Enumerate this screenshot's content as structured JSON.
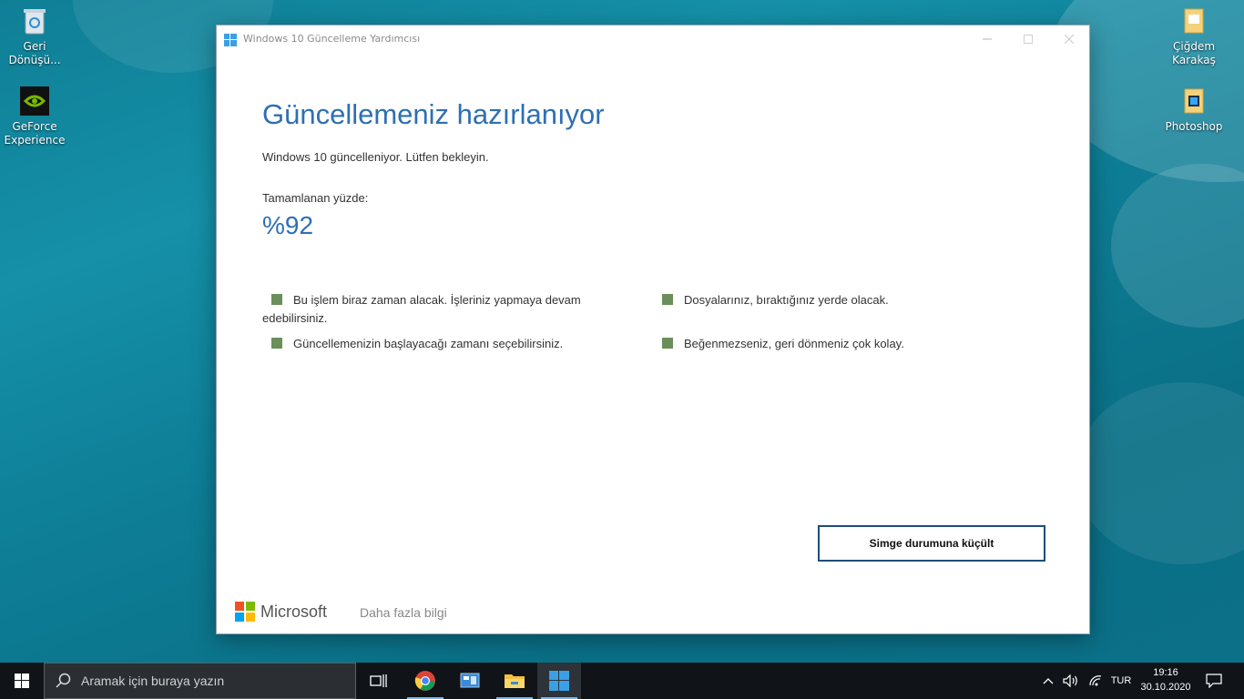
{
  "desktop": {
    "icons": [
      {
        "label": "Geri Dönüşü..."
      },
      {
        "label": "GeForce Experience"
      },
      {
        "label": "Çiğdem Karakaş"
      },
      {
        "label": "Photoshop"
      }
    ]
  },
  "window": {
    "title": "Windows 10 Güncelleme Yardımcısı",
    "heading": "Güncellemeniz hazırlanıyor",
    "subtitle": "Windows 10 güncelleniyor. Lütfen bekleyin.",
    "progress_label": "Tamamlanan yüzde:",
    "progress_value": "%92",
    "progress_percent": 92,
    "features": [
      "Bu işlem biraz zaman alacak. İşleriniz yapmaya devam edebilirsiniz.",
      "Dosyalarınız, bıraktığınız yerde olacak.",
      "Güncellemenizin başlayacağı zamanı seçebilirsiniz.",
      "Beğenmezseniz, geri dönmeniz çok kolay."
    ],
    "minimize_button": "Simge durumuna küçült",
    "brand": "Microsoft",
    "more_info": "Daha fazla bilgi"
  },
  "taskbar": {
    "search_placeholder": "Aramak için buraya yazın",
    "language": "TUR",
    "time": "19:16",
    "date": "30.10.2020"
  },
  "colors": {
    "accent": "#2e6fb4",
    "bullet": "#6a8f5a",
    "button_border": "#1e4d78",
    "taskbar": "#101418"
  }
}
